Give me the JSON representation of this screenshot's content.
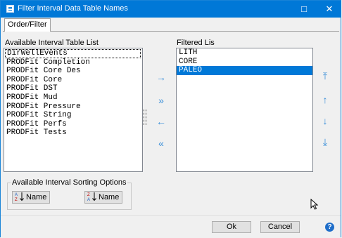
{
  "window": {
    "title": "Filter Interval Data Table Names",
    "controls": {
      "maximize": "□",
      "close": "✕"
    }
  },
  "tabs": [
    {
      "label": "Order/Filter"
    }
  ],
  "available": {
    "label": "Available Interval Table List",
    "items": [
      "DirWellEvents",
      "PRODFit Completion",
      "PRODFit Core Des",
      "PRODFit Core",
      "PRODFit DST",
      "PRODFit Mud",
      "PRODFit Pressure",
      "PRODFit String",
      "PRODFit Perfs",
      "PRODFit Tests"
    ],
    "focused_index": 0
  },
  "filtered": {
    "label": "Filtered Lis",
    "items": [
      "LITH",
      "CORE",
      "PALEO"
    ],
    "selected_index": 2
  },
  "transfer_buttons": {
    "add": "→",
    "add_all": "»",
    "remove": "←",
    "remove_all": "«"
  },
  "order_buttons": {
    "top": "⤒",
    "up": "↑",
    "down": "↓",
    "bottom": "⤓"
  },
  "sorting": {
    "label": "Available Interval Sorting Options",
    "asc_label": "Name",
    "desc_label": "Name"
  },
  "footer": {
    "ok": "Ok",
    "cancel": "Cancel",
    "help": "?"
  },
  "colors": {
    "titlebar": "#0078d7",
    "selection": "#0078d7",
    "arrows": "#3a8fd9"
  }
}
